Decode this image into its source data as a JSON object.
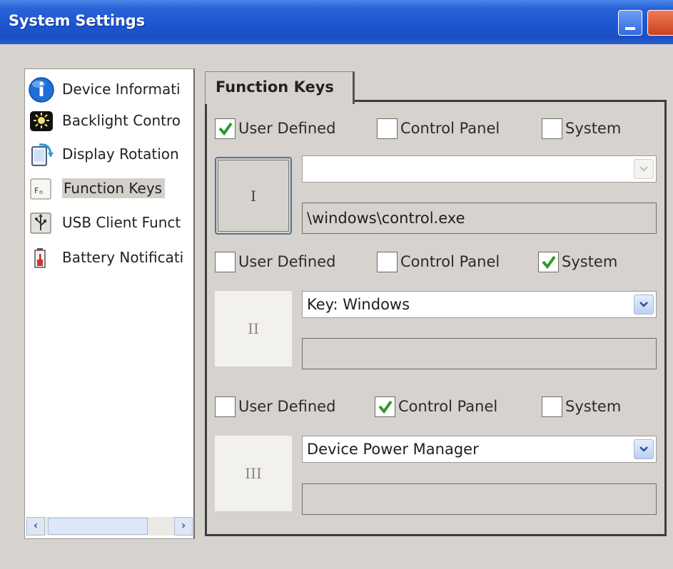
{
  "window": {
    "title": "System Settings"
  },
  "sidebar": {
    "items": [
      {
        "label": "Device Informati",
        "icon": "info-icon"
      },
      {
        "label": "Backlight Contro",
        "icon": "backlight-icon"
      },
      {
        "label": "Display Rotation",
        "icon": "display-rotation-icon"
      },
      {
        "label": "Function Keys",
        "icon": "function-keys-icon",
        "selected": true
      },
      {
        "label": "USB Client Funct",
        "icon": "usb-icon"
      },
      {
        "label": "Battery Notificati",
        "icon": "battery-icon"
      }
    ]
  },
  "tab": {
    "label": "Function Keys"
  },
  "keys": [
    {
      "key_label": "I",
      "options": {
        "user_defined": "User Defined",
        "control_panel": "Control Panel",
        "system": "System"
      },
      "checked": "user_defined",
      "combo_value": "",
      "path_value": "\\windows\\control.exe"
    },
    {
      "key_label": "II",
      "options": {
        "user_defined": "User Defined",
        "control_panel": "Control Panel",
        "system": "System"
      },
      "checked": "system",
      "combo_value": "Key: Windows",
      "path_value": ""
    },
    {
      "key_label": "III",
      "options": {
        "user_defined": "User Defined",
        "control_panel": "Control Panel",
        "system": "System"
      },
      "checked": "control_panel",
      "combo_value": "Device Power Manager",
      "path_value": ""
    }
  ],
  "colors": {
    "titlebar": "#1b56d2",
    "check": "#2e9a2e",
    "background": "#d6d3ce"
  }
}
